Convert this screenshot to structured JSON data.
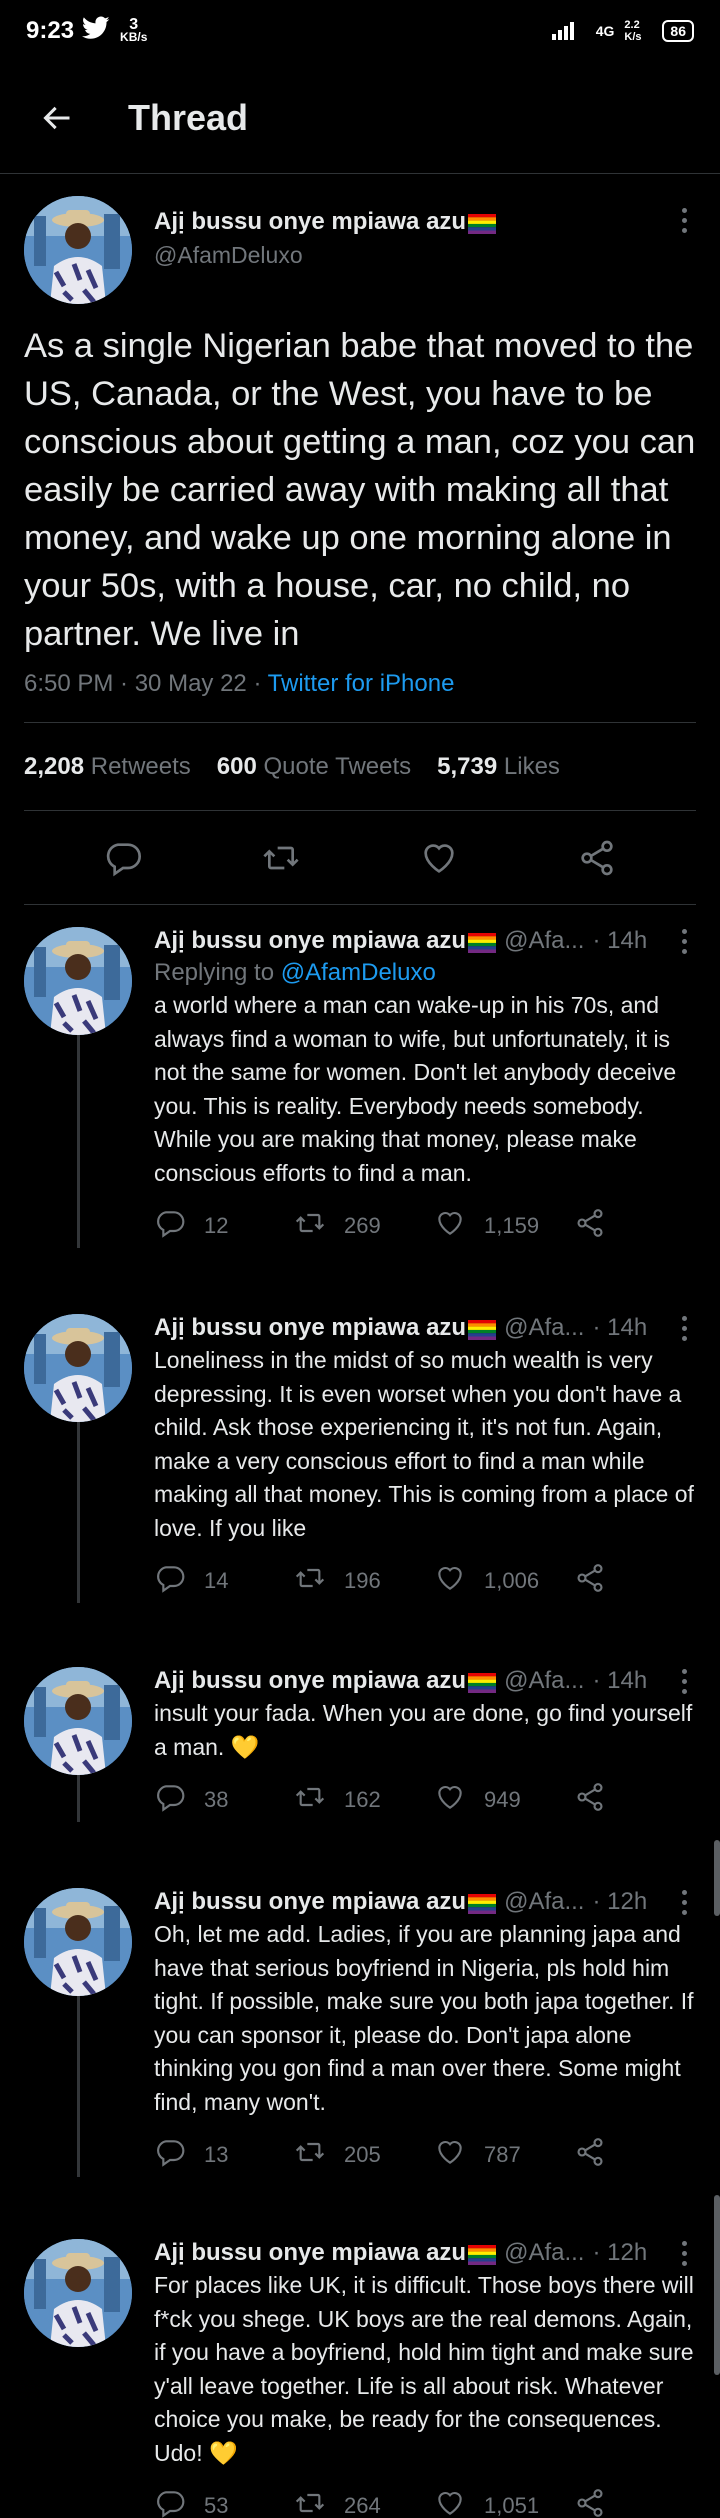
{
  "status": {
    "time": "9:23",
    "speed_value": "3",
    "speed_unit": "KB/s",
    "right_net": "4G",
    "right_speed": "2.2 K/s",
    "battery": "86"
  },
  "header": {
    "title": "Thread"
  },
  "main_tweet": {
    "name": "Ajị bussu onye mpiawa azu",
    "handle": "@AfamDeluxo",
    "text": "As a single Nigerian babe that moved to the US, Canada, or the West, you have to be conscious about getting a man, coz you can easily be carried away with making all that money, and wake up one morning alone in your 50s, with a house, car, no child, no partner. We live in",
    "time": "6:50 PM · 30 May 22 · ",
    "source": "Twitter for iPhone",
    "retweets_count": "2,208",
    "retweets_label": "Retweets",
    "quotes_count": "600",
    "quotes_label": "Quote Tweets",
    "likes_count": "5,739",
    "likes_label": "Likes"
  },
  "replies": [
    {
      "name": "Ajị bussu onye mpiawa azu",
      "handle": "@Afa...",
      "time": "· 14h",
      "replying_prefix": "Replying to ",
      "replying_to": "@AfamDeluxo",
      "text": "a world where a man can wake-up in his 70s, and always find a woman to wife, but unfortunately, it is not the same for women. Don't let anybody deceive you. This is reality. Everybody needs somebody. While you are making that money, please make conscious efforts to find a man.",
      "replies": "12",
      "retweets": "269",
      "likes": "1,159"
    },
    {
      "name": "Ajị bussu onye mpiawa azu",
      "handle": "@Afa...",
      "time": "· 14h",
      "text": "Loneliness in the midst of so much wealth is very depressing. It is even worset when you don't have a child. Ask those experiencing it, it's not fun. Again, make a very conscious effort to find a man while making all that money. This is coming from a place of love. If you like",
      "replies": "14",
      "retweets": "196",
      "likes": "1,006"
    },
    {
      "name": "Ajị bussu onye mpiawa azu",
      "handle": "@Afa...",
      "time": "· 14h",
      "text": "insult your fada. When you are done, go find yourself a man. 💛",
      "replies": "38",
      "retweets": "162",
      "likes": "949"
    },
    {
      "name": "Ajị bussu onye mpiawa azu",
      "handle": "@Afa...",
      "time": "· 12h",
      "text": "Oh, let me add. Ladies, if you are planning japa and have that serious boyfriend in Nigeria, pls hold him tight. If possible, make sure you both japa together. If you can sponsor it, please do. Don't japa alone thinking you gon find a man over there.  Some might find, many won't.",
      "replies": "13",
      "retweets": "205",
      "likes": "787"
    },
    {
      "name": "Ajị bussu onye mpiawa azu",
      "handle": "@Afa...",
      "time": "· 12h",
      "text": "For places like UK, it is difficult. Those boys there will f*ck you shege. UK boys are the real demons. Again, if you have a boyfriend, hold him tight and make sure y'all leave together. Life is all about risk. Whatever choice you make, be ready for the consequences. Udo! 💛",
      "replies": "53",
      "retweets": "264",
      "likes": "1,051"
    }
  ],
  "colors": {
    "background": "#000000",
    "text": "#e7e9ea",
    "muted": "#71767b",
    "link": "#1d9bf0",
    "divider": "#2f3336"
  }
}
